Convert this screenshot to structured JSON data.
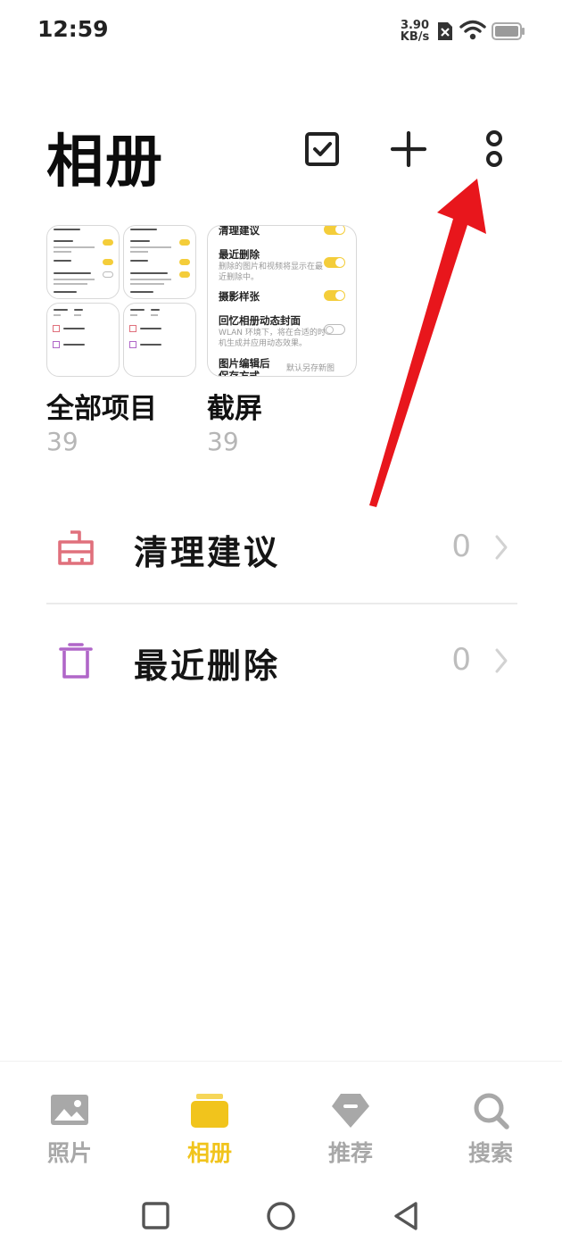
{
  "status_bar": {
    "time": "12:59",
    "net_speed_value": "3.90",
    "net_speed_unit": "KB/s"
  },
  "header": {
    "title": "相册",
    "select_icon": "checkbox-icon",
    "add_icon": "plus-icon",
    "more_icon": "more-vertical-icon"
  },
  "albums": [
    {
      "name": "全部项目",
      "count": "39"
    },
    {
      "name": "截屏",
      "count": "39"
    }
  ],
  "screenshot_thumb": {
    "items": [
      {
        "title": "清理建议"
      },
      {
        "title": "最近删除",
        "desc1": "删除的图片和视频将显示在最",
        "desc2": "近删除中。"
      },
      {
        "title": "摄影样张"
      },
      {
        "title": "回忆相册动态封面",
        "desc1": "WLAN 环境下，将在合适的时",
        "desc2": "机生成并应用动态效果。"
      },
      {
        "title": "图片编辑后",
        "title2": "保存方式",
        "value": "默认另存新图"
      }
    ]
  },
  "list_rows": [
    {
      "label": "清理建议",
      "count": "0",
      "icon": "broom-icon",
      "color": "#e0707c"
    },
    {
      "label": "最近删除",
      "count": "0",
      "icon": "trash-icon",
      "color": "#b066c8"
    }
  ],
  "tabs": [
    {
      "label": "照片",
      "icon": "image-icon",
      "active": false
    },
    {
      "label": "相册",
      "icon": "album-icon",
      "active": true
    },
    {
      "label": "推荐",
      "icon": "tag-icon",
      "active": false
    },
    {
      "label": "搜索",
      "icon": "search-icon",
      "active": false
    }
  ],
  "colors": {
    "accent": "#f1c41c",
    "annotation_arrow": "#e8161c"
  }
}
